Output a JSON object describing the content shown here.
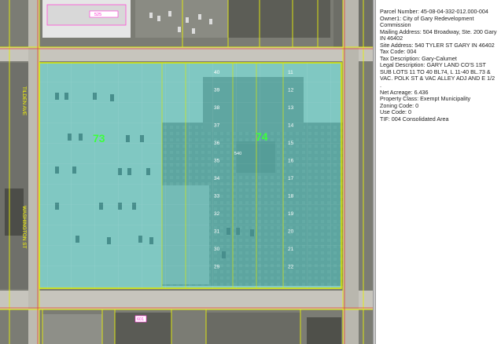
{
  "parcel_info": {
    "fields": [
      {
        "label": "Parcel Number",
        "value": "45-08-04-332-012.000-004"
      },
      {
        "label": "Owner1",
        "value": "City of Gary Redevelopment Commission"
      },
      {
        "label": "Mailing Address",
        "value": "504  Broadway, Ste. 200 Gary IN 46402"
      },
      {
        "label": "Site Address",
        "value": "540  TYLER ST GARY IN 46402"
      },
      {
        "label": "Tax Code",
        "value": "004"
      },
      {
        "label": "Tax Description",
        "value": "Gary-Calumet"
      },
      {
        "label": "Legal Description",
        "value": "GARY LAND CO'S 1ST SUB LOTS 11 TO 40 BL74, L 11-40 BL.73 & VAC. POLK ST & VAC ALLEY ADJ  AND E 1/2 ."
      },
      {
        "label": "Net Acreage",
        "value": "6.436"
      },
      {
        "label": "Property Class",
        "value": "Exempt Municipality"
      },
      {
        "label": "Zoning Code",
        "value": "0"
      },
      {
        "label": "Use Code",
        "value": "0"
      },
      {
        "label": "TIF",
        "value": "004 Consolidated Area"
      }
    ]
  },
  "map": {
    "block_labels": [
      "73",
      "74"
    ],
    "street_labels": [
      "TILDEN AVE",
      "WASHINGTON ST"
    ],
    "colors": {
      "parcel_fill": "#5fe0dc",
      "parcel_outline": "#d6e80a",
      "block_label": "#3cff3c",
      "lot_number": "#ffffff",
      "address_label": "#ff2ad4",
      "road_fill": "#c7c5bd"
    },
    "lot_numbers_left": [
      "40",
      "39",
      "38",
      "37",
      "36",
      "35",
      "34",
      "33",
      "32",
      "31",
      "30",
      "29"
    ],
    "lot_numbers_right": [
      "11",
      "12",
      "13",
      "14",
      "15",
      "16",
      "17",
      "18",
      "19",
      "20",
      "21",
      "22"
    ],
    "address_labels": [
      "540",
      "525",
      "601"
    ]
  }
}
